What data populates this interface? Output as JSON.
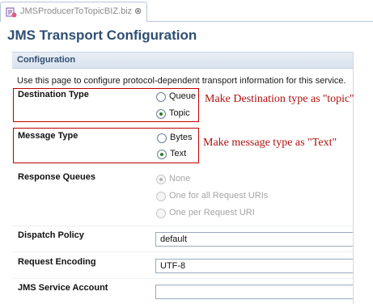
{
  "tab": {
    "title": "JMSProducerToTopicBIZ.biz",
    "close_glyph": "⊗",
    "icon": "biz-file-icon"
  },
  "page": {
    "title": "JMS Transport Configuration"
  },
  "section": {
    "title": "Configuration",
    "description": "Use this page to configure protocol-dependent transport information for this service."
  },
  "destination_type": {
    "label": "Destination Type",
    "options": [
      {
        "label": "Queue",
        "selected": false
      },
      {
        "label": "Topic",
        "selected": true
      }
    ],
    "annotation": "Make Destination type as ''topic''"
  },
  "message_type": {
    "label": "Message Type",
    "options": [
      {
        "label": "Bytes",
        "selected": false
      },
      {
        "label": "Text",
        "selected": true
      }
    ],
    "annotation": "Make message type as \"Text\""
  },
  "response_queues": {
    "label": "Response Queues",
    "options": [
      {
        "label": "None",
        "selected": true,
        "enabled": false
      },
      {
        "label": "One for all Request URIs",
        "selected": false,
        "enabled": false
      },
      {
        "label": "One per Request URI",
        "selected": false,
        "enabled": false
      }
    ]
  },
  "dispatch_policy": {
    "label": "Dispatch Policy",
    "value": "default"
  },
  "request_encoding": {
    "label": "Request Encoding",
    "value": "UTF-8"
  },
  "jms_service_account": {
    "label": "JMS Service Account",
    "value": ""
  },
  "colors": {
    "title": "#2f4f73",
    "annotation": "#b01010",
    "radio_selected": "#2c7a2c"
  }
}
